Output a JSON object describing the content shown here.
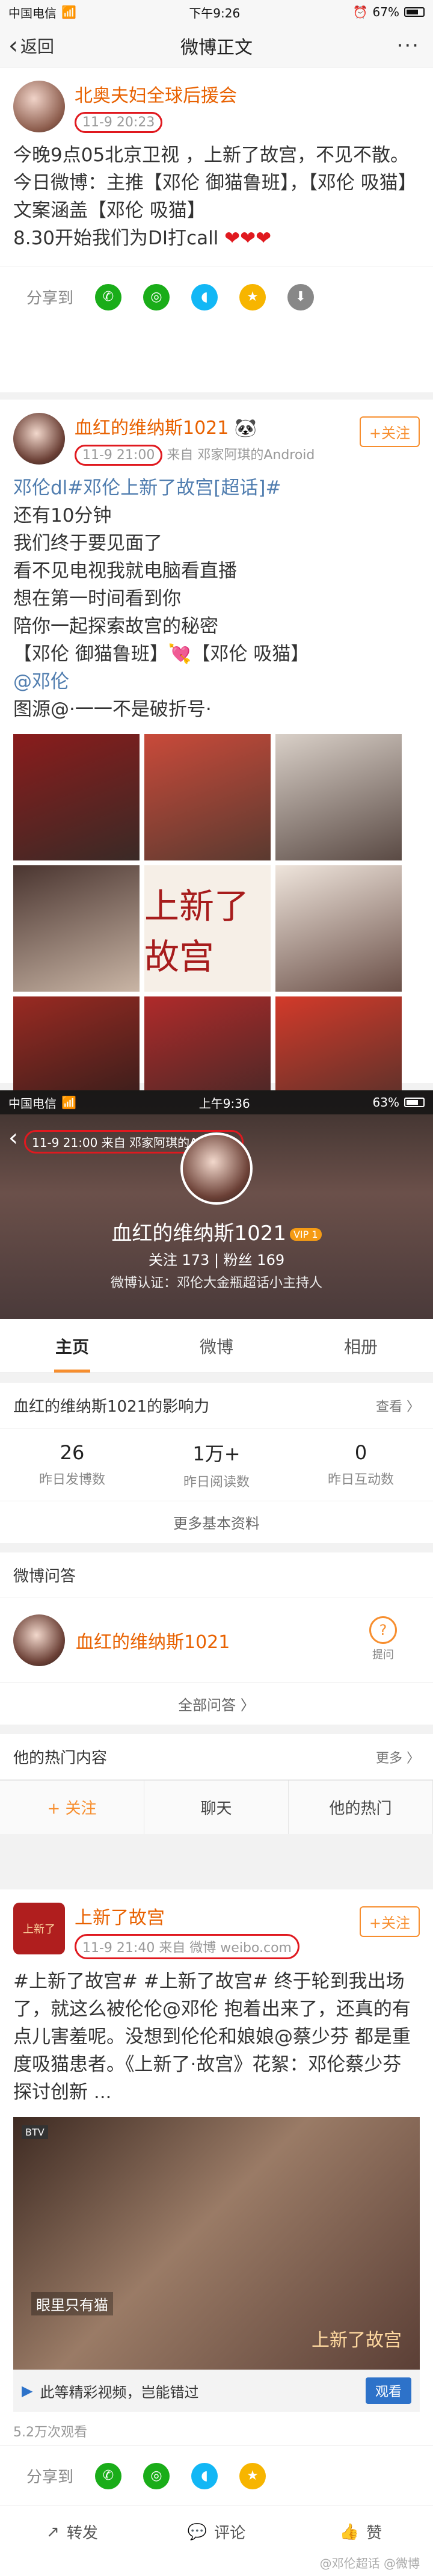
{
  "status1": {
    "carrier": "中国电信",
    "time": "下午9:26",
    "battery": "67%"
  },
  "nav1": {
    "back": "返回",
    "title": "微博正文",
    "more": "···"
  },
  "post1": {
    "name": "北奥夫妇全球后援会",
    "time": "11-9 20:23",
    "text": "今晚9点05北京卫视 ，上新了故宫，不见不散。\n今日微博：主推【邓伦 御猫鲁班】，【邓伦 吸猫】\n文案涵盖【邓伦 吸猫】\n8.30开始我们为DI打call",
    "hearts": "❤❤❤",
    "share_label": "分享到"
  },
  "post2": {
    "name": "血红的维纳斯1021",
    "time": "11-9 21:00",
    "source": "来自 邓家阿琪的Android",
    "follow": "+关注",
    "topic": "邓伦dl#邓伦上新了故宫[超话]#",
    "text": "还有10分钟\n我们终于要见面了\n看不见电视我就电脑看直播\n想在第一时间看到你\n陪你一起探索故宫的秘密\n【邓伦 御猫鲁班】💘【邓伦 吸猫】",
    "mention": "@邓伦",
    "credit": "图源@·一一不是破折号·",
    "grid_title": "上新了故宫",
    "actions": {
      "forward": "转发",
      "comment": "评论",
      "like": "赞"
    }
  },
  "status2": {
    "carrier": "中国电信",
    "time": "上午9:36",
    "battery": "63%"
  },
  "profile": {
    "name": "血红的维纳斯1021",
    "vip": "VIP 1",
    "stats": "关注 173 | 粉丝 169",
    "auth": "微博认证：邓伦大金瓶超话小主持人",
    "time_circled": "11-9 21:00 来自 邓家阿琪的Android",
    "tabs": [
      "主页",
      "微博",
      "相册"
    ],
    "influence_title": "血红的维纳斯1021的影响力",
    "influence_more": "查看 〉",
    "influence": [
      {
        "num": "26",
        "label": "昨日发博数"
      },
      {
        "num": "1万+",
        "label": "昨日阅读数"
      },
      {
        "num": "0",
        "label": "昨日互动数"
      }
    ],
    "more_info": "更多基本资料",
    "qa_title": "微博问答",
    "qa_name": "血红的维纳斯1021",
    "ask": "提问",
    "hot_title": "他的热门内容",
    "hot_more": "更多 〉",
    "bottom": [
      "+ 关注",
      "聊天",
      "他的热门"
    ]
  },
  "post3": {
    "name": "上新了故宫",
    "logo": "上新了",
    "time": "11-9 21:40 来自 微博 weibo.com",
    "follow": "+关注",
    "text": "#上新了故宫# #上新了故宫# 终于轮到我出场了，就这么被伦伦@邓伦 抱着出来了，还真的有点儿害羞呢。没想到伦伦和娘娘@蔡少芬 都是重度吸猫患者。《上新了·故宫》花絮：邓伦蔡少芬探讨创新 ...",
    "video_badge": "BTV",
    "video_caption": "眼里只有猫 ",
    "video_watermark": "上新了故宫",
    "promo": "此等精彩视频，岂能错过",
    "promo_btn": "观看",
    "views": "5.2万次观看",
    "share_label": "分享到",
    "actions": {
      "forward": "转发",
      "comment": "评论",
      "like": "赞"
    },
    "footer_mark": "@邓伦超话 @微博"
  }
}
